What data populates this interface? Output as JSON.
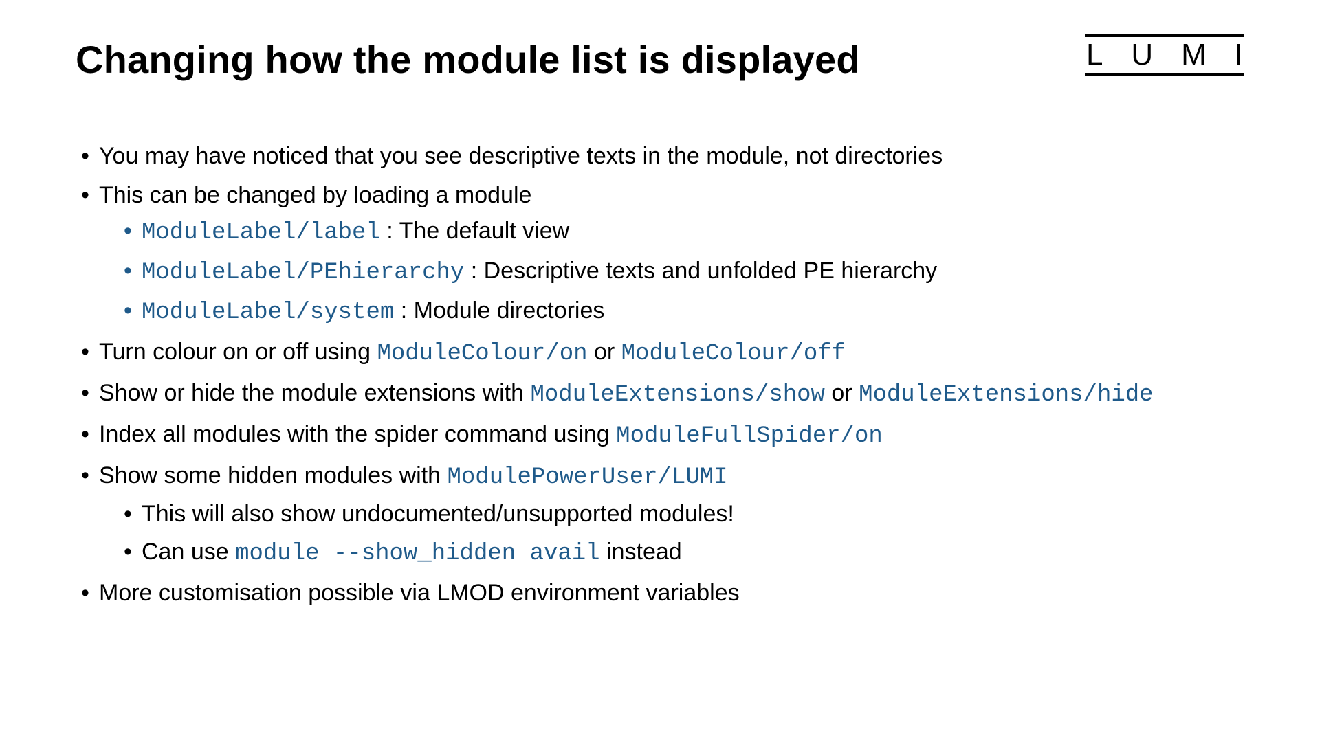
{
  "title": "Changing how the module list is displayed",
  "logo": {
    "l1": "L",
    "l2": "U",
    "l3": "M",
    "l4": "I"
  },
  "b1": "You may have noticed that you see descriptive texts in the module, not directories",
  "b2": "This can be changed by loading a module",
  "b2a_code": "ModuleLabel/label",
  "b2a_text": " : The default view",
  "b2b_code": "ModuleLabel/PEhierarchy",
  "b2b_text": " : Descriptive texts and unfolded PE hierarchy",
  "b2c_code": "ModuleLabel/system",
  "b2c_text": " : Module directories",
  "b3_pre": "Turn colour on or off using ",
  "b3_code1": "ModuleColour/on",
  "b3_mid": " or ",
  "b3_code2": "ModuleColour/off",
  "b4_pre": "Show or hide the module extensions with ",
  "b4_code1": "ModuleExtensions/show",
  "b4_mid": " or ",
  "b4_code2": "ModuleExtensions/hide",
  "b5_pre": "Index all modules with the spider command using ",
  "b5_code": "ModuleFullSpider/on",
  "b6_pre": "Show some hidden modules with ",
  "b6_code": "ModulePowerUser/LUMI",
  "b6a": "This will also show undocumented/unsupported modules!",
  "b6b_pre": "Can use ",
  "b6b_code": "module --show_hidden avail",
  "b6b_post": "  instead",
  "b7": "More customisation possible via LMOD environment variables"
}
